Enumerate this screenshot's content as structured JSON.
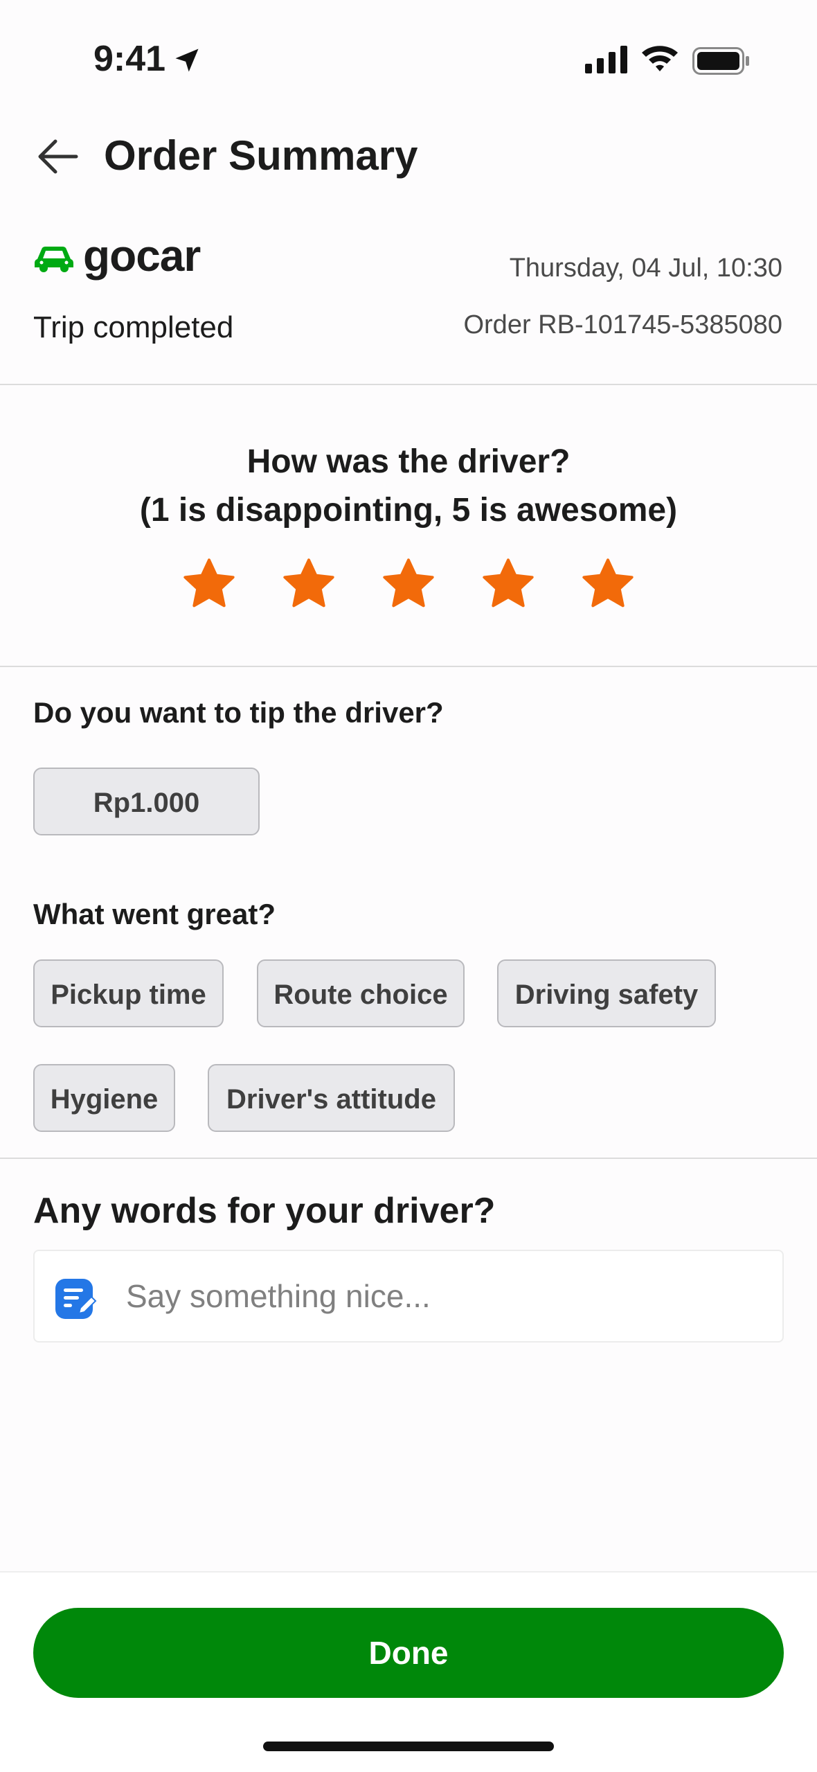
{
  "status_bar": {
    "time": "9:41",
    "icons": [
      "location-arrow-icon",
      "signal-icon",
      "wifi-icon",
      "battery-icon"
    ]
  },
  "header": {
    "title": "Order Summary",
    "back_icon": "arrow-left-icon"
  },
  "order": {
    "brand": "gocar",
    "brand_color": "#00aa13",
    "date": "Thursday, 04 Jul, 10:30",
    "status": "Trip completed",
    "order_id": "Order RB-101745-5385080"
  },
  "rating": {
    "question_line1": "How was the driver?",
    "question_line2": "(1 is disappointing, 5 is awesome)",
    "value": 5,
    "max": 5,
    "star_color": "#f26a0a"
  },
  "tip": {
    "question": "Do you want to tip the driver?",
    "options": [
      "Rp1.000"
    ]
  },
  "feedback": {
    "question": "What went great?",
    "chips": [
      "Pickup time",
      "Route choice",
      "Driving safety",
      "Hygiene",
      "Driver's attitude"
    ]
  },
  "comment": {
    "question": "Any words for your driver?",
    "placeholder": "Say something nice...",
    "value": "",
    "icon": "edit-note-icon"
  },
  "footer": {
    "done_label": "Done",
    "done_color": "#00880a"
  }
}
